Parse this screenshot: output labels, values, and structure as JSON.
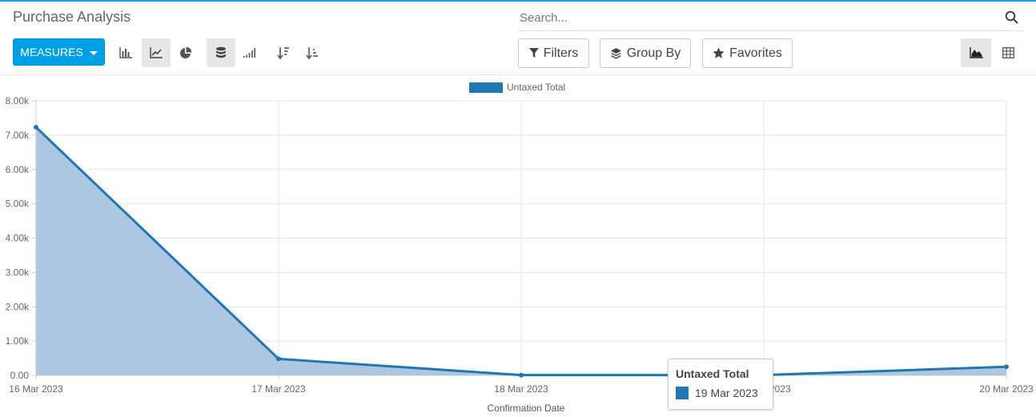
{
  "page": {
    "title": "Purchase Analysis",
    "accent_color": "#1a9ed9"
  },
  "search": {
    "placeholder": "Search...",
    "icon": "search-icon"
  },
  "toolbar": {
    "measures_label": "MEASURES",
    "chart_type_buttons": [
      "bar-chart-icon",
      "line-chart-icon",
      "pie-chart-icon"
    ],
    "active_chart_type": "line",
    "stack_button": "stack-icon",
    "cumulative_button": "cumulative-icon",
    "sort_desc_button": "sort-descending-icon",
    "sort_asc_button": "sort-ascending-icon",
    "filters_label": "Filters",
    "groupby_label": "Group By",
    "favorites_label": "Favorites",
    "view_graph_icon": "area-chart-icon",
    "view_pivot_icon": "pivot-table-icon"
  },
  "chart_data": {
    "type": "area",
    "categories": [
      "16 Mar 2023",
      "17 Mar 2023",
      "18 Mar 2023",
      "19 Mar 2023",
      "20 Mar 2023"
    ],
    "series": [
      {
        "name": "Untaxed Total",
        "values": [
          7230,
          480,
          10,
          10,
          250
        ],
        "color": "#1f77b4",
        "fill": "#aec7e0"
      }
    ],
    "xlabel": "Confirmation Date",
    "ylabel": "",
    "ylim": [
      0,
      8000
    ],
    "yticks": [
      "0.00",
      "1.00k",
      "2.00k",
      "3.00k",
      "4.00k",
      "5.00k",
      "6.00k",
      "7.00k",
      "8.00k"
    ],
    "grid": true,
    "legend": "top-center"
  },
  "tooltip": {
    "title": "Untaxed Total",
    "label": "19 Mar 2023"
  }
}
